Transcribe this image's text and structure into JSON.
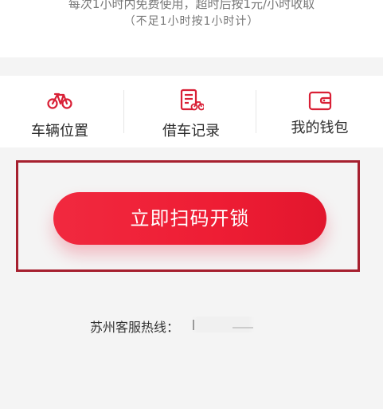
{
  "rules": {
    "line1": "每次1小时内免费使用，超时后按1元/小时收取",
    "line2": "（不足1小时按1小时计）"
  },
  "shortcuts": [
    {
      "label": "车辆位置",
      "icon": "bicycle-icon"
    },
    {
      "label": "借车记录",
      "icon": "record-icon"
    },
    {
      "label": "我的钱包",
      "icon": "wallet-icon"
    }
  ],
  "unlock": {
    "label": "立即扫码开锁"
  },
  "hotline": {
    "label": "苏州客服热线："
  },
  "colors": {
    "accent": "#e8203a",
    "highlight_border": "#a6202f",
    "background": "#f4f4f4"
  }
}
